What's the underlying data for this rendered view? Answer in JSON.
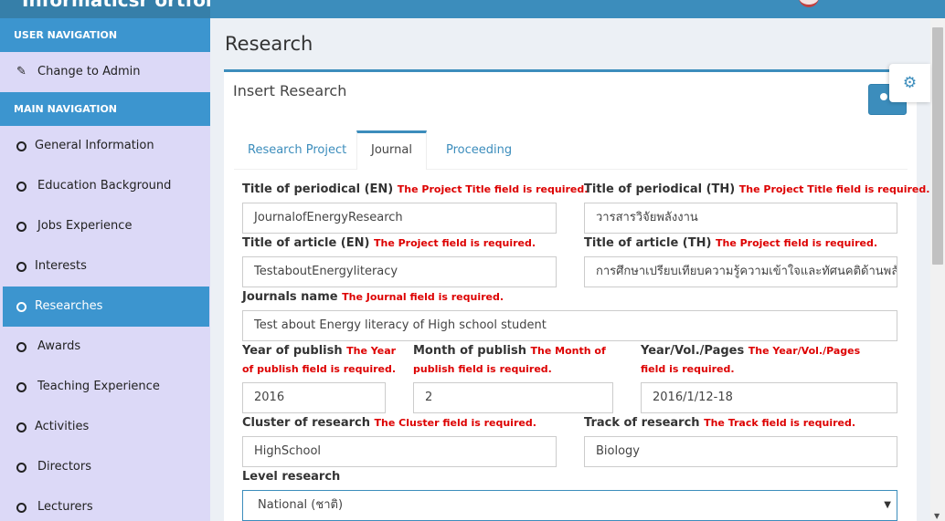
{
  "app": {
    "title": "Informaticsr ortfolio"
  },
  "sidebar": {
    "user_header": "USER NAVIGATION",
    "user_items": [
      {
        "label": "Change to Admin",
        "icon": "edit-icon"
      }
    ],
    "main_header": "MAIN NAVIGATION",
    "items": [
      {
        "label": "General Information"
      },
      {
        "label": "Education Background"
      },
      {
        "label": "Jobs Experience"
      },
      {
        "label": "Interests"
      },
      {
        "label": "Researches",
        "active": true
      },
      {
        "label": "Awards"
      },
      {
        "label": "Teaching Experience"
      },
      {
        "label": "Activities"
      },
      {
        "label": "Directors"
      },
      {
        "label": "Lecturers"
      }
    ]
  },
  "page": {
    "title": "Research"
  },
  "box": {
    "title": "Insert Research"
  },
  "tabs": [
    {
      "label": "Research Project"
    },
    {
      "label": "Journal",
      "active": true
    },
    {
      "label": "Proceeding"
    }
  ],
  "form": {
    "title_periodical_en": {
      "label": "Title of periodical (EN)",
      "error": "The Project Title field is required.",
      "value": "JournalofEnergyResearch"
    },
    "title_periodical_th": {
      "label": "Title of periodical (TH)",
      "error": "The Project Title field is required.",
      "value": "วารสารวิจัยพลังงาน"
    },
    "title_article_en": {
      "label": "Title of article (EN)",
      "error": "The Project field is required.",
      "value": "TestaboutEnergyliteracy"
    },
    "title_article_th": {
      "label": "Title of article (TH)",
      "error": "The Project field is required.",
      "value": "การศึกษาเปรียบเทียบความรู้ความเข้าใจและทัศนคติด้านพลังงาน"
    },
    "journals_name": {
      "label": "Journals name",
      "error": "The Journal field is required.",
      "value": "Test about Energy literacy of High school student"
    },
    "year_publish": {
      "label": "Year of publish",
      "error": "The Year of publish field is required.",
      "value": "2016"
    },
    "month_publish": {
      "label": "Month of publish",
      "error": "The Month of publish field is required.",
      "value": "2"
    },
    "year_vol_pages": {
      "label": "Year/Vol./Pages",
      "error": "The Year/Vol./Pages field is required.",
      "value": "2016/1/12-18"
    },
    "cluster": {
      "label": "Cluster of research",
      "error": "The Cluster field is required.",
      "value": "HighSchool"
    },
    "track": {
      "label": "Track of research",
      "error": "The Track field is required.",
      "value": "Biology"
    },
    "level": {
      "label": "Level research",
      "value": "National (ชาติ)"
    }
  },
  "colors": {
    "primary": "#3c8dbc",
    "sidebar_bg": "#dcd9f7",
    "error": "#dd0000"
  }
}
